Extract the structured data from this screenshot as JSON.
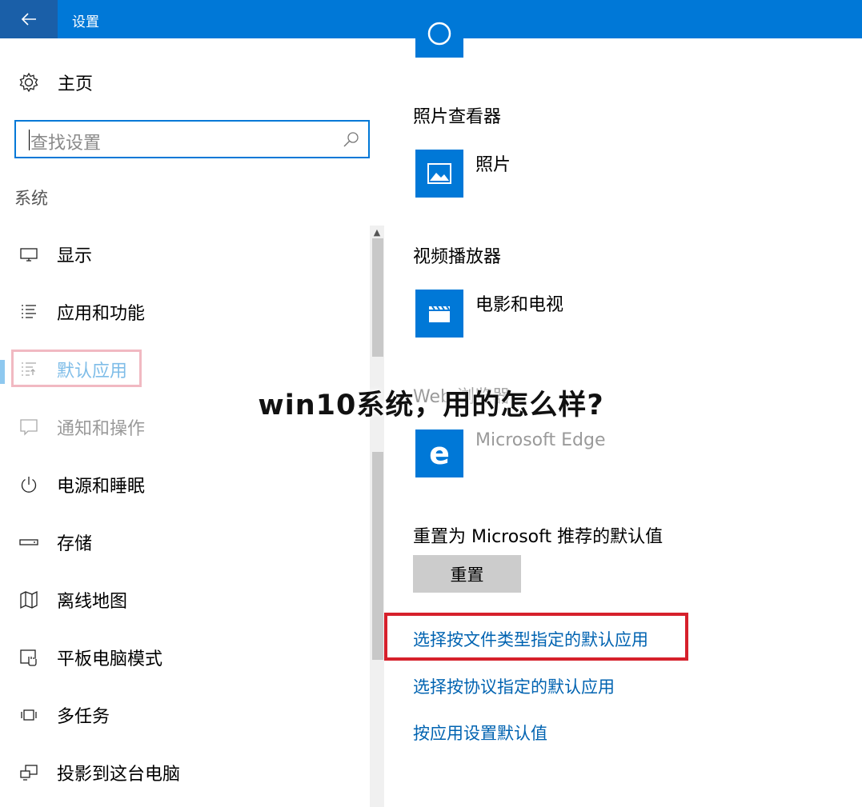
{
  "window": {
    "title": "设置"
  },
  "nav": {
    "home_label": "主页",
    "search_placeholder": "查找设置",
    "section_title": "系统",
    "items": [
      {
        "label": "显示",
        "icon": "monitor-icon"
      },
      {
        "label": "应用和功能",
        "icon": "list-icon"
      },
      {
        "label": "默认应用",
        "icon": "default-apps-icon",
        "active": true
      },
      {
        "label": "通知和操作",
        "icon": "notification-icon"
      },
      {
        "label": "电源和睡眠",
        "icon": "power-icon"
      },
      {
        "label": "存储",
        "icon": "storage-icon"
      },
      {
        "label": "离线地图",
        "icon": "map-icon"
      },
      {
        "label": "平板电脑模式",
        "icon": "tablet-mode-icon"
      },
      {
        "label": "多任务",
        "icon": "multitask-icon"
      },
      {
        "label": "投影到这台电脑",
        "icon": "projection-icon"
      }
    ]
  },
  "content": {
    "photo_viewer_heading": "照片查看器",
    "photo_app": "照片",
    "video_player_heading": "视频播放器",
    "video_app": "电影和电视",
    "web_browser_heading": "Web 浏览器",
    "browser_app": "Microsoft Edge",
    "reset_heading": "重置为 Microsoft 推荐的默认值",
    "reset_button": "重置",
    "links": [
      "选择按文件类型指定的默认应用",
      "选择按协议指定的默认应用",
      "按应用设置默认值"
    ]
  },
  "overlay_caption": "win10系统，用的怎么样?",
  "colors": {
    "accent": "#0078d7",
    "link": "#0063b1",
    "highlight_box": "#d6202b"
  }
}
